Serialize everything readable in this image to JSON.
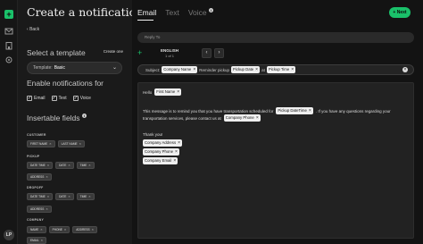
{
  "rail": {
    "logo": "+",
    "icons": [
      "mail-icon",
      "building-icon",
      "settings-icon"
    ],
    "avatar": "LP"
  },
  "left": {
    "title": "Create a notification",
    "back": "Back",
    "template_section": "Select a template",
    "create_one": "Create one",
    "template_label": "Template:",
    "template_value": "Basic",
    "enable_section": "Enable notifications for",
    "channels": [
      {
        "label": "Email",
        "checked": true
      },
      {
        "label": "Text",
        "checked": true
      },
      {
        "label": "Voice",
        "checked": true
      }
    ],
    "insertable_section": "Insertable fields",
    "groups": [
      {
        "label": "CUSTOMER",
        "chips": [
          "FIRST NAME",
          "LAST NAME"
        ]
      },
      {
        "label": "PICKUP",
        "chips": [
          "DATE TIME",
          "DATE",
          "TIME"
        ],
        "chips2": [
          "ADDRESS"
        ]
      },
      {
        "label": "DROPOFF",
        "chips": [
          "DATE TIME",
          "DATE",
          "TIME"
        ],
        "chips2": [
          "ADDRESS"
        ]
      },
      {
        "label": "COMPANY",
        "chips": [
          "NAME",
          "PHONE",
          "ADDRESS"
        ],
        "chips2": [
          "EMAIL"
        ]
      }
    ]
  },
  "main": {
    "tabs": [
      "Email",
      "Text",
      "Voice"
    ],
    "next": "+ Next",
    "reply_placeholder": "Reply To",
    "language": "ENGLISH",
    "language_page": "1 of 1",
    "subject_label": "Subject:",
    "subject_text_1": "Reminder pickup",
    "subject_text_2": "at",
    "subject_chips": [
      "Company Name",
      "Pickup Date",
      "Pickup Time"
    ],
    "body": {
      "hello": "Hello",
      "first_name": "First Name",
      "msg_part1": "This message is to remind you that you have transportation scheduled for",
      "pickup_dt": "Pickup DateTime",
      "msg_part2": ". If you have any questions regarding your",
      "msg_part3": "transportation services, please contact us at",
      "company_phone": "Company Phone",
      "thank_you": "Thank you!",
      "sig": [
        "Company Address",
        "Company Phone",
        "Company Email"
      ]
    }
  },
  "colors": {
    "accent": "#1ac16a",
    "bg": "#131313",
    "panel": "#1a1a1a"
  }
}
